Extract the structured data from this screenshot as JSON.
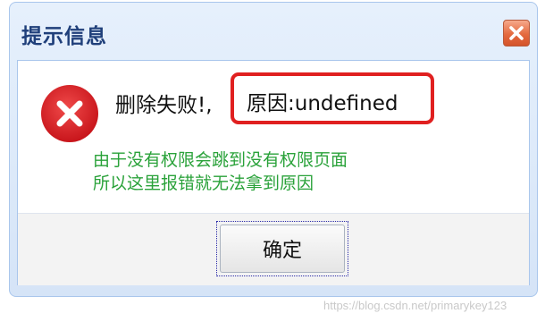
{
  "dialog": {
    "title": "提示信息",
    "close_icon": "close-icon",
    "message_prefix": "删除失败!,",
    "message_reason": "原因:undefined",
    "error_icon": "error-icon",
    "note_lines": [
      "由于没有权限会跳到没有权限页面",
      "所以这里报错就无法拿到原因"
    ],
    "ok_button_label": "确定"
  },
  "watermark": "https://blog.csdn.net/primarykey123",
  "colors": {
    "title_text": "#1f3f7a",
    "highlight_border": "#e02020",
    "note_text": "#2aa23a",
    "error_icon": "#d8242a",
    "close_button": "#e46a3f"
  }
}
